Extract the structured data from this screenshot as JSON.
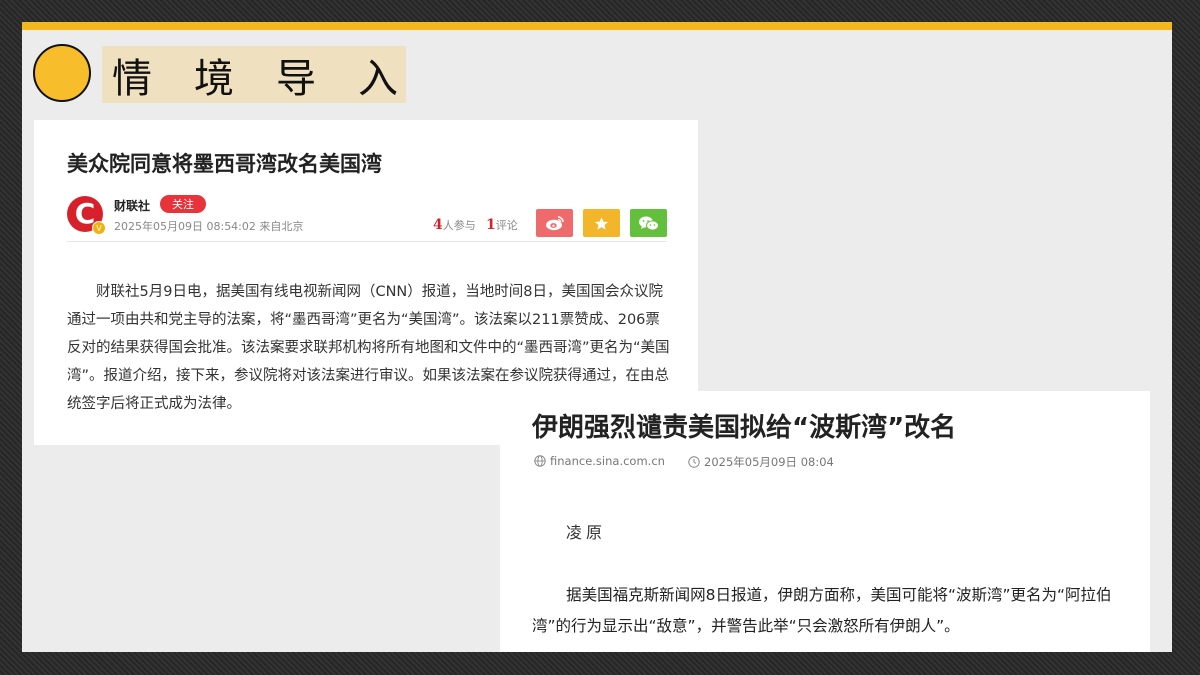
{
  "slide": {
    "heading_chars": [
      "情",
      "境",
      "导",
      "入"
    ],
    "accent_color": "#f4b81e"
  },
  "article1": {
    "title": "美众院同意将墨西哥湾改名美国湾",
    "source": {
      "logo_letter": "C",
      "badge": "V",
      "name": "财联社",
      "follow_label": "关注",
      "datetime": "2025年05月09日 08:54:02 来自北京"
    },
    "stats": {
      "participants_count": "4",
      "participants_label": "人参与",
      "comments_count": "1",
      "comments_label": "评论"
    },
    "share_icons": [
      "weibo-icon",
      "star-icon",
      "wechat-icon"
    ],
    "share_colors": [
      "#ef6b6b",
      "#f3b52a",
      "#62c03c"
    ],
    "body": "财联社5月9日电，据美国有线电视新闻网（CNN）报道，当地时间8日，美国国会众议院通过一项由共和党主导的法案，将“墨西哥湾”更名为“美国湾”。该法案以211票赞成、206票反对的结果获得国会批准。该法案要求联邦机构将所有地图和文件中的“墨西哥湾”更名为“美国湾”。报道介绍，接下来，参议院将对该法案进行审议。如果该法案在参议院获得通过，在由总统签字后将正式成为法律。"
  },
  "article2": {
    "title": "伊朗强烈谴责美国拟给“波斯湾”改名",
    "site": "finance.sina.com.cn",
    "datetime": "2025年05月09日 08:04",
    "author": "凌原",
    "body": "据美国福克斯新闻网8日报道，伊朗方面称，美国可能将“波斯湾”更名为“阿拉伯湾”的行为显示出“敌意”，并警告此举“只会激怒所有伊朗人”。"
  }
}
